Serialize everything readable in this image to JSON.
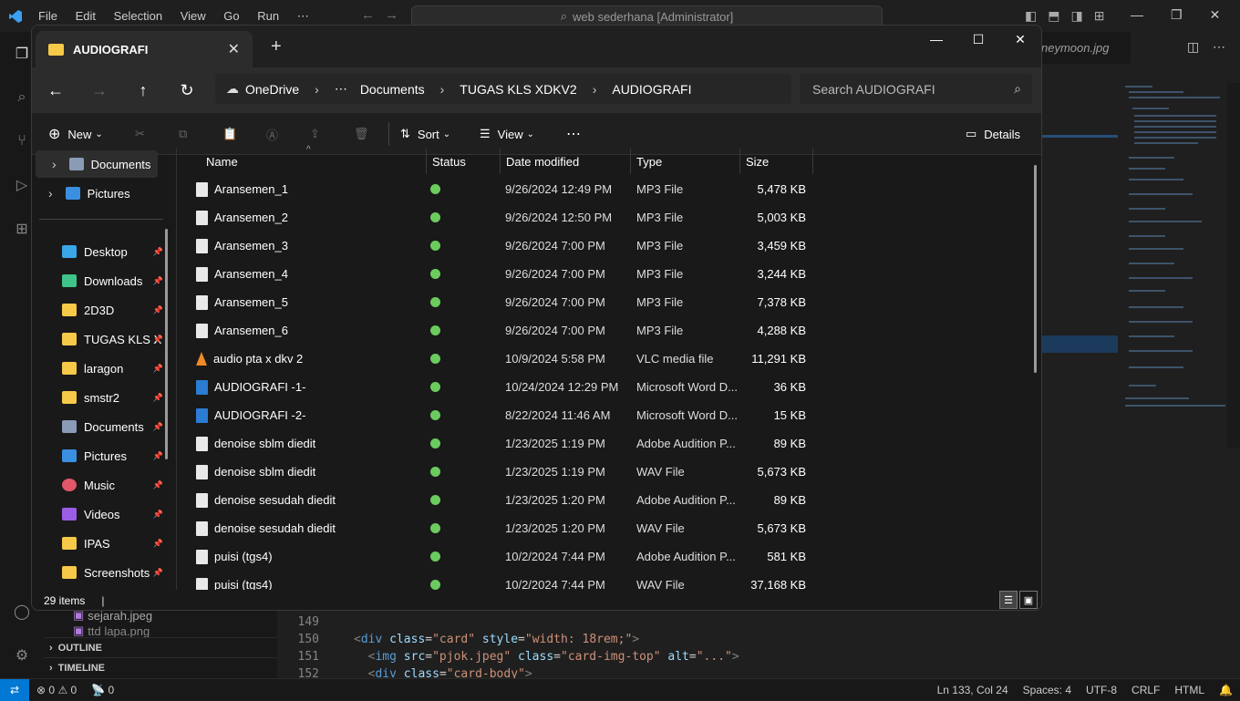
{
  "vscode": {
    "menu": [
      "File",
      "Edit",
      "Selection",
      "View",
      "Go",
      "Run",
      "⋯"
    ],
    "command_center": "web sederhana [Administrator]",
    "partial_tab": "neymoon.jpg",
    "sidebar_files": [
      "sejarah.jpeg",
      "ttd lapa.png"
    ],
    "outline_label": "OUTLINE",
    "timeline_label": "TIMELINE",
    "line_numbers": [
      "149",
      "150",
      "151",
      "152"
    ],
    "status": {
      "errors": "0",
      "warnings": "0",
      "ports": "0",
      "position": "Ln 133, Col 24",
      "spaces": "Spaces: 4",
      "encoding": "UTF-8",
      "eol": "CRLF",
      "language": "HTML"
    }
  },
  "explorer": {
    "tab_title": "AUDIOGRAFI",
    "breadcrumb": [
      "OneDrive",
      "⋯",
      "Documents",
      "TUGAS KLS XDKV2",
      "AUDIOGRAFI"
    ],
    "search_placeholder": "Search AUDIOGRAFI",
    "toolbar": {
      "new": "New",
      "sort": "Sort",
      "view": "View",
      "more": "⋯",
      "details": "Details"
    },
    "nav_items": [
      {
        "label": "Documents",
        "icon": "documents-icon",
        "color": "#8a9bb5"
      },
      {
        "label": "Pictures",
        "icon": "pictures-icon",
        "color": "#3b8fe0"
      },
      {
        "label": "Desktop",
        "icon": "desktop-icon",
        "color": "#3aa6e8"
      },
      {
        "label": "Downloads",
        "icon": "download-icon",
        "color": "#3ec48a"
      },
      {
        "label": "2D3D",
        "icon": "folder-icon",
        "color": "#f7c948"
      },
      {
        "label": "TUGAS KLS X",
        "icon": "folder-icon",
        "color": "#f7c948"
      },
      {
        "label": "laragon",
        "icon": "folder-icon",
        "color": "#f7c948"
      },
      {
        "label": "smstr2",
        "icon": "folder-icon",
        "color": "#f7c948"
      },
      {
        "label": "Documents",
        "icon": "documents-icon",
        "color": "#8a9bb5"
      },
      {
        "label": "Pictures",
        "icon": "pictures-icon",
        "color": "#3b8fe0"
      },
      {
        "label": "Music",
        "icon": "music-icon",
        "color": "#e0576a"
      },
      {
        "label": "Videos",
        "icon": "videos-icon",
        "color": "#9b5de5"
      },
      {
        "label": "IPAS",
        "icon": "folder-icon",
        "color": "#f7c948"
      },
      {
        "label": "Screenshots",
        "icon": "folder-icon",
        "color": "#f7c948"
      }
    ],
    "columns": {
      "name": "Name",
      "status": "Status",
      "date": "Date modified",
      "type": "Type",
      "size": "Size"
    },
    "files": [
      {
        "name": "Aransemen_1",
        "date": "9/26/2024 12:49 PM",
        "type": "MP3 File",
        "size": "5,478 KB",
        "icon": "mp3-file-icon",
        "color": "#e9e9e9"
      },
      {
        "name": "Aransemen_2",
        "date": "9/26/2024 12:50 PM",
        "type": "MP3 File",
        "size": "5,003 KB",
        "icon": "mp3-file-icon",
        "color": "#e9e9e9"
      },
      {
        "name": "Aransemen_3",
        "date": "9/26/2024 7:00 PM",
        "type": "MP3 File",
        "size": "3,459 KB",
        "icon": "mp3-file-icon",
        "color": "#e9e9e9"
      },
      {
        "name": "Aransemen_4",
        "date": "9/26/2024 7:00 PM",
        "type": "MP3 File",
        "size": "3,244 KB",
        "icon": "mp3-file-icon",
        "color": "#e9e9e9"
      },
      {
        "name": "Aransemen_5",
        "date": "9/26/2024 7:00 PM",
        "type": "MP3 File",
        "size": "7,378 KB",
        "icon": "mp3-file-icon",
        "color": "#e9e9e9"
      },
      {
        "name": "Aransemen_6",
        "date": "9/26/2024 7:00 PM",
        "type": "MP3 File",
        "size": "4,288 KB",
        "icon": "mp3-file-icon",
        "color": "#e9e9e9"
      },
      {
        "name": "audio pta x dkv 2",
        "date": "10/9/2024 5:58 PM",
        "type": "VLC media file",
        "size": "11,291 KB",
        "icon": "vlc-icon",
        "color": "#f08a24"
      },
      {
        "name": "AUDIOGRAFI -1-",
        "date": "10/24/2024 12:29 PM",
        "type": "Microsoft Word D...",
        "size": "36 KB",
        "icon": "word-file-icon",
        "color": "#2b7cd3"
      },
      {
        "name": "AUDIOGRAFI -2-",
        "date": "8/22/2024 11:46 AM",
        "type": "Microsoft Word D...",
        "size": "15 KB",
        "icon": "word-file-icon",
        "color": "#2b7cd3"
      },
      {
        "name": "denoise sblm diedit",
        "date": "1/23/2025 1:19 PM",
        "type": "Adobe Audition P...",
        "size": "89 KB",
        "icon": "audition-file-icon",
        "color": "#e9e9e9"
      },
      {
        "name": "denoise sblm diedit",
        "date": "1/23/2025 1:19 PM",
        "type": "WAV File",
        "size": "5,673 KB",
        "icon": "wav-file-icon",
        "color": "#e9e9e9"
      },
      {
        "name": "denoise sesudah diedit",
        "date": "1/23/2025 1:20 PM",
        "type": "Adobe Audition P...",
        "size": "89 KB",
        "icon": "audition-file-icon",
        "color": "#e9e9e9"
      },
      {
        "name": "denoise sesudah diedit",
        "date": "1/23/2025 1:20 PM",
        "type": "WAV File",
        "size": "5,673 KB",
        "icon": "wav-file-icon",
        "color": "#e9e9e9"
      },
      {
        "name": "puisi (tgs4)",
        "date": "10/2/2024 7:44 PM",
        "type": "Adobe Audition P...",
        "size": "581 KB",
        "icon": "audition-file-icon",
        "color": "#e9e9e9"
      },
      {
        "name": "puisi (tgs4)",
        "date": "10/2/2024 7:44 PM",
        "type": "WAV File",
        "size": "37,168 KB",
        "icon": "wav-file-icon",
        "color": "#e9e9e9"
      }
    ],
    "item_count": "29 items"
  }
}
